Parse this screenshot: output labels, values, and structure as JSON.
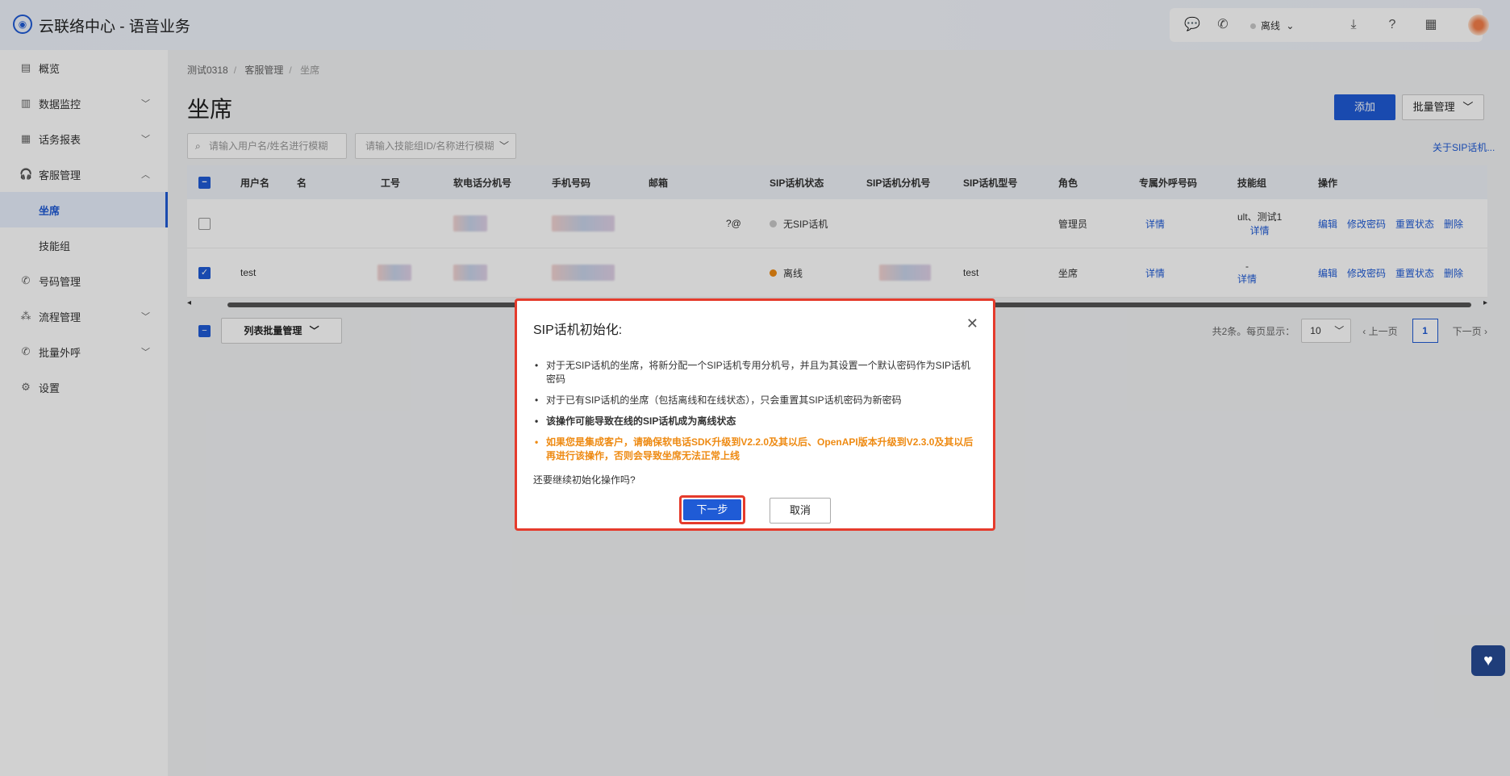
{
  "header": {
    "app_title": "云联络中心 - 语音业务",
    "status_label": "离线"
  },
  "sidebar": {
    "items": [
      {
        "label": "概览",
        "icon": "overview-icon"
      },
      {
        "label": "数据监控",
        "icon": "monitor-icon"
      },
      {
        "label": "话务报表",
        "icon": "report-icon"
      },
      {
        "label": "客服管理",
        "icon": "headset-icon"
      },
      {
        "label": "坐席"
      },
      {
        "label": "技能组"
      },
      {
        "label": "号码管理",
        "icon": "phone-icon"
      },
      {
        "label": "流程管理",
        "icon": "flow-icon"
      },
      {
        "label": "批量外呼",
        "icon": "batch-call-icon"
      },
      {
        "label": "设置",
        "icon": "gear-icon"
      }
    ]
  },
  "breadcrumb": [
    "测试0318",
    "客服管理",
    "坐席"
  ],
  "page_title": "坐席",
  "buttons": {
    "add": "添加",
    "batch": "批量管理",
    "list_batch": "列表批量管理"
  },
  "search": {
    "user_placeholder": "请输入用户名/姓名进行模糊",
    "skill_placeholder": "请输入技能组ID/名称进行模糊"
  },
  "about_link": "关于SIP话机...",
  "table": {
    "headers": [
      "用户名",
      "名",
      "工号",
      "软电话分机号",
      "手机号码",
      "邮箱",
      "SIP话机状态",
      "SIP话机分机号",
      "SIP话机型号",
      "角色",
      "专属外呼号码",
      "技能组",
      "操作"
    ],
    "rows": [
      {
        "username": "",
        "email_suffix": "?@",
        "sip_status": "无SIP话机",
        "sip_status_color": "#c9c9c9",
        "sip_model": "",
        "role": "管理员",
        "outbound": "详情",
        "skill": "ult、测试1",
        "skill_link": "详情",
        "checked": false
      },
      {
        "username": "test",
        "email_suffix": "",
        "sip_status": "离线",
        "sip_status_color": "#ee8a12",
        "sip_model": "test",
        "role": "坐席",
        "outbound": "详情",
        "skill": "-",
        "skill_link": "详情",
        "checked": true
      }
    ],
    "ops": [
      "编辑",
      "修改密码",
      "重置状态",
      "删除"
    ]
  },
  "pager": {
    "total": "共2条。每页显示：",
    "page_size": "10",
    "prev": "上一页",
    "current": "1",
    "next": "下一页"
  },
  "dialog": {
    "title": "SIP话机初始化:",
    "items": [
      "对于无SIP话机的坐席，将新分配一个SIP话机专用分机号，并且为其设置一个默认密码作为SIP话机密码",
      "对于已有SIP话机的坐席（包括离线和在线状态），只会重置其SIP话机密码为新密码",
      "该操作可能导致在线的SIP话机成为离线状态",
      "如果您是集成客户，请确保软电话SDK升级到V2.2.0及其以后、OpenAPI版本升级到V2.3.0及其以后再进行该操作，否则会导致坐席无法正常上线"
    ],
    "question": "还要继续初始化操作吗?",
    "next": "下一步",
    "cancel": "取消"
  },
  "colors": {
    "primary": "#1f5bd6",
    "warning": "#ee8a12",
    "highlight": "#e53b2c"
  }
}
